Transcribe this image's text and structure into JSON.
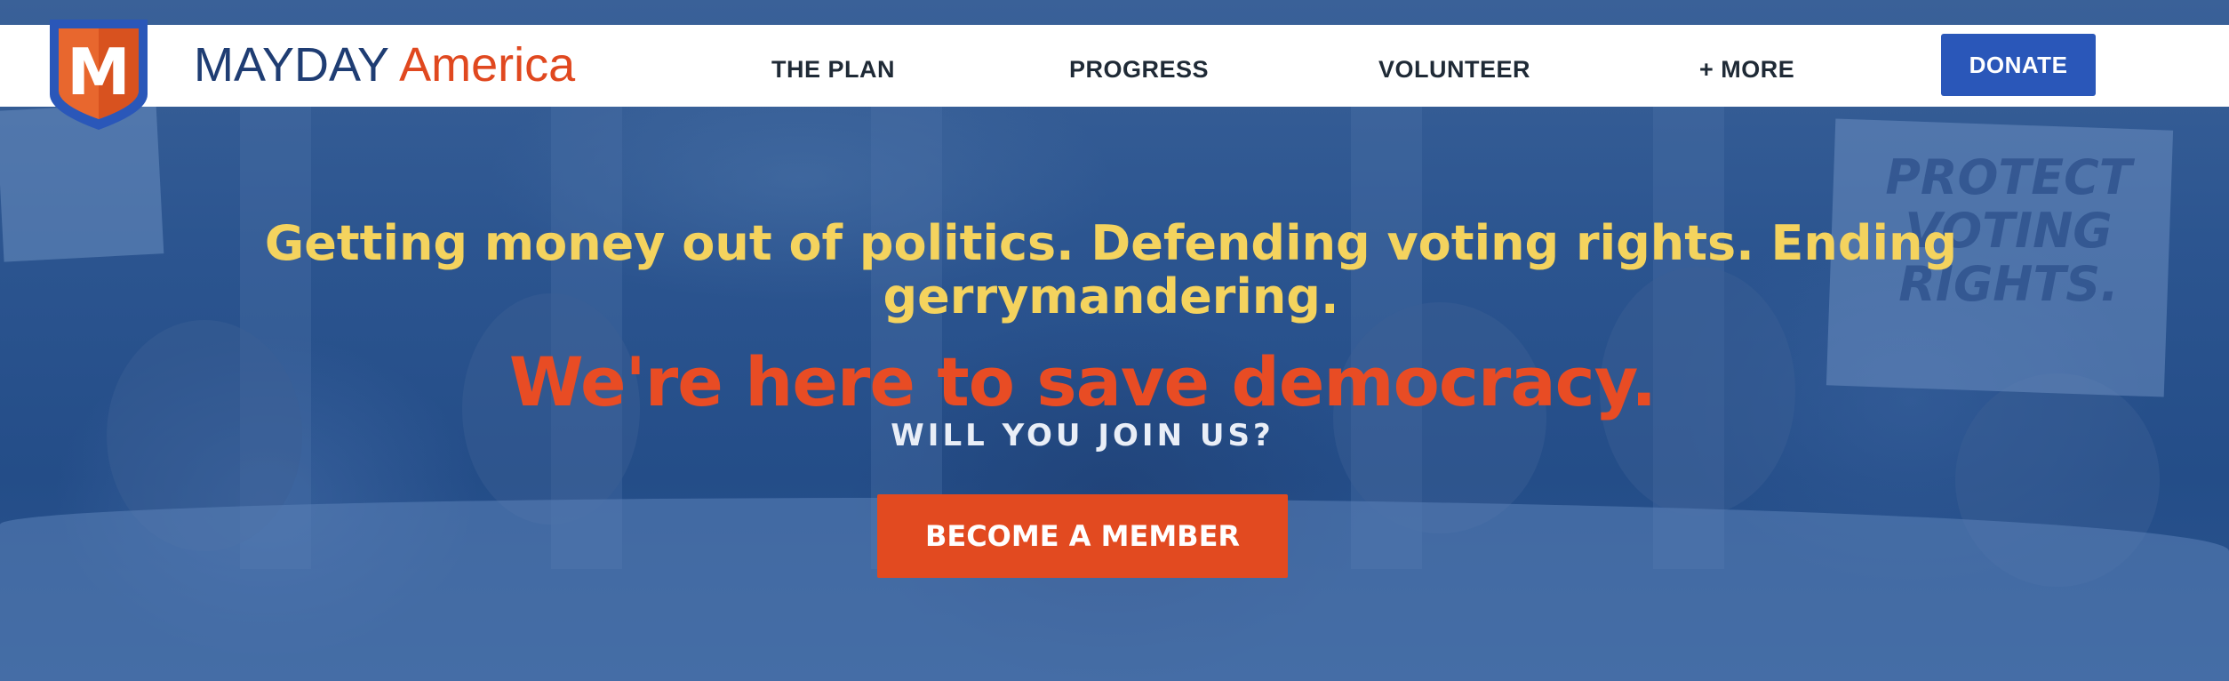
{
  "header": {
    "brand_part1": "MAYDAY",
    "brand_part2": "America",
    "logo_letter": "M",
    "nav": [
      {
        "label": "THE PLAN"
      },
      {
        "label": "PROGRESS"
      },
      {
        "label": "VOLUNTEER"
      },
      {
        "label": "+ MORE"
      }
    ],
    "donate_label": "DONATE"
  },
  "hero": {
    "headline": "Getting money out of politics. Defending voting rights. Ending gerrymandering.",
    "tagline": "We're here to save democracy.",
    "subhead": "WILL YOU JOIN US?",
    "cta_label": "BECOME A MEMBER",
    "background_sign_text": "PROTECT VOTING RIGHTS."
  },
  "colors": {
    "brand_navy": "#1f3d73",
    "brand_orange": "#e0481f",
    "donate_blue": "#2a57b9",
    "headline_yellow": "#f4d35e",
    "tagline_orange": "#e84c24",
    "hero_blue": "#2b5591"
  }
}
